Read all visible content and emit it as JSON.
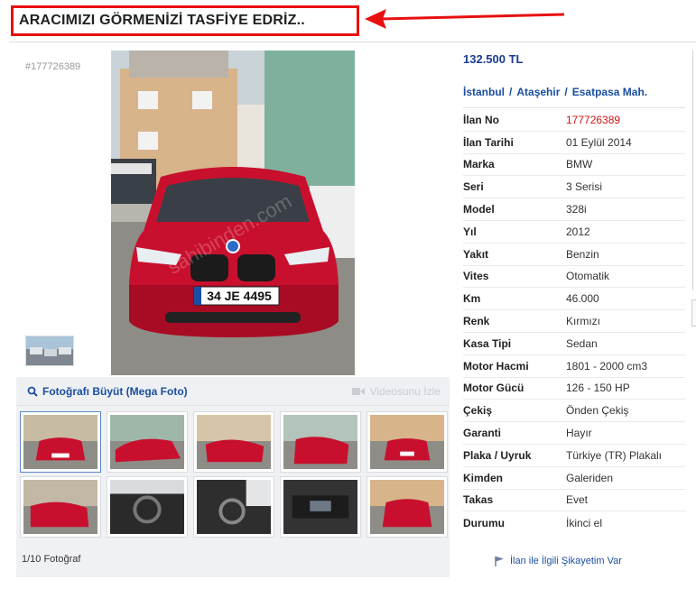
{
  "header": {
    "title": "ARACIMIZI GÖRMENİZİ TASFİYE EDRİZ.."
  },
  "gallery": {
    "ad_id": "#177726389",
    "enlarge_label": "Fotoğrafı Büyüt (Mega Foto)",
    "video_label": "Videosunu İzle",
    "photo_count": "1/10 Fotoğraf",
    "plate_text": "34 JE 4495",
    "watermark": "sahibinden.com"
  },
  "listing": {
    "price": "132.500 TL",
    "location": {
      "city": "İstanbul",
      "district": "Ataşehir",
      "neighborhood": "Esatpasa Mah."
    },
    "rows": [
      {
        "label": "İlan No",
        "value": "177726389"
      },
      {
        "label": "İlan Tarihi",
        "value": "01 Eylül 2014"
      },
      {
        "label": "Marka",
        "value": "BMW"
      },
      {
        "label": "Seri",
        "value": "3 Serisi"
      },
      {
        "label": "Model",
        "value": "328i"
      },
      {
        "label": "Yıl",
        "value": "2012"
      },
      {
        "label": "Yakıt",
        "value": "Benzin"
      },
      {
        "label": "Vites",
        "value": "Otomatik"
      },
      {
        "label": "Km",
        "value": "46.000"
      },
      {
        "label": "Renk",
        "value": "Kırmızı"
      },
      {
        "label": "Kasa Tipi",
        "value": "Sedan"
      },
      {
        "label": "Motor Hacmi",
        "value": "1801 - 2000 cm3"
      },
      {
        "label": "Motor Gücü",
        "value": "126 - 150 HP"
      },
      {
        "label": "Çekiş",
        "value": "Önden Çekiş"
      },
      {
        "label": "Garanti",
        "value": "Hayır"
      },
      {
        "label": "Plaka / Uyruk",
        "value": "Türkiye (TR) Plakalı"
      },
      {
        "label": "Kimden",
        "value": "Galeriden"
      },
      {
        "label": "Takas",
        "value": "Evet"
      },
      {
        "label": "Durumu",
        "value": "İkinci el"
      }
    ],
    "complaint_label": "İlan ile İlgili Şikayetim Var"
  },
  "colors": {
    "accent": "#1a4fa0",
    "price": "#1a3d8f",
    "highlight_red": "#e81010",
    "car_red": "#c8102e"
  },
  "icons": [
    "arrow-annotation",
    "magnifier-icon",
    "video-camera-icon",
    "flag-icon"
  ]
}
